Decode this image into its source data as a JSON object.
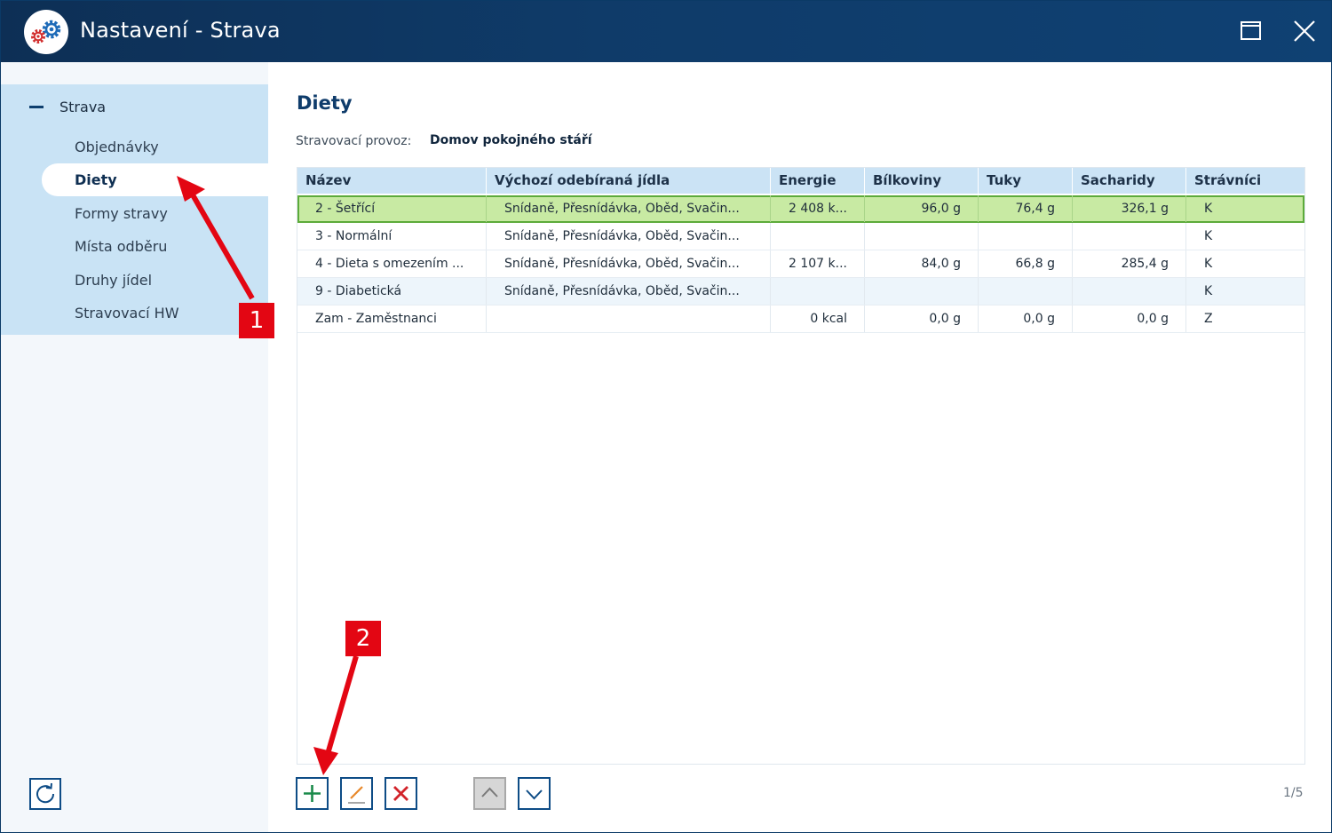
{
  "window": {
    "title": "Nastavení - Strava"
  },
  "sidebar": {
    "root": "Strava",
    "items": [
      {
        "label": "Objednávky"
      },
      {
        "label": "Diety",
        "selected": true
      },
      {
        "label": "Formy stravy"
      },
      {
        "label": "Místa odběru"
      },
      {
        "label": "Druhy jídel"
      },
      {
        "label": "Stravovací HW"
      }
    ]
  },
  "main": {
    "title": "Diety",
    "provider_label": "Stravovací provoz:",
    "provider_value": "Domov pokojného stáří"
  },
  "table": {
    "columns": [
      "Název",
      "Výchozí odebíraná jídla",
      "Energie",
      "Bílkoviny",
      "Tuky",
      "Sacharidy",
      "Strávníci"
    ],
    "rows": [
      [
        "2 - Šetřící",
        "Snídaně, Přesnídávka, Oběd, Svačin...",
        "2 408 k...",
        "96,0 g",
        "76,4 g",
        "326,1 g",
        "K"
      ],
      [
        "3 - Normální",
        "Snídaně, Přesnídávka, Oběd, Svačin...",
        "",
        "",
        "",
        "",
        "K"
      ],
      [
        "4 - Dieta s omezením ...",
        "Snídaně, Přesnídávka, Oběd, Svačin...",
        "2 107 k...",
        "84,0 g",
        "66,8 g",
        "285,4 g",
        "K"
      ],
      [
        "9 - Diabetická",
        "Snídaně, Přesnídávka, Oběd, Svačin...",
        "",
        "",
        "",
        "",
        "K"
      ],
      [
        "Zam - Zaměstnanci",
        "",
        "0 kcal",
        "0,0 g",
        "0,0 g",
        "0,0 g",
        "Z"
      ]
    ],
    "selected_row": 0
  },
  "pager": "1/5",
  "annotations": {
    "badge1": "1",
    "badge2": "2"
  },
  "colors": {
    "titlebar": "#0f3b69",
    "sidebar_selection": "#c9e3f5",
    "row_selected": "#c8eaa3",
    "row_selected_border": "#5cab3a",
    "annotation": "#e30613",
    "add_icon": "#1a8a4a",
    "delete_icon": "#d2232a",
    "edit_icon": "#e8882a"
  },
  "icons": {
    "app": "settings-gears-icon",
    "maximize": "maximize-icon",
    "close": "close-icon",
    "collapse": "minus-icon",
    "refresh": "refresh-icon",
    "add": "plus-icon",
    "edit": "pencil-icon",
    "delete": "x-icon",
    "move_up": "chevron-up-icon",
    "move_down": "chevron-down-icon"
  }
}
